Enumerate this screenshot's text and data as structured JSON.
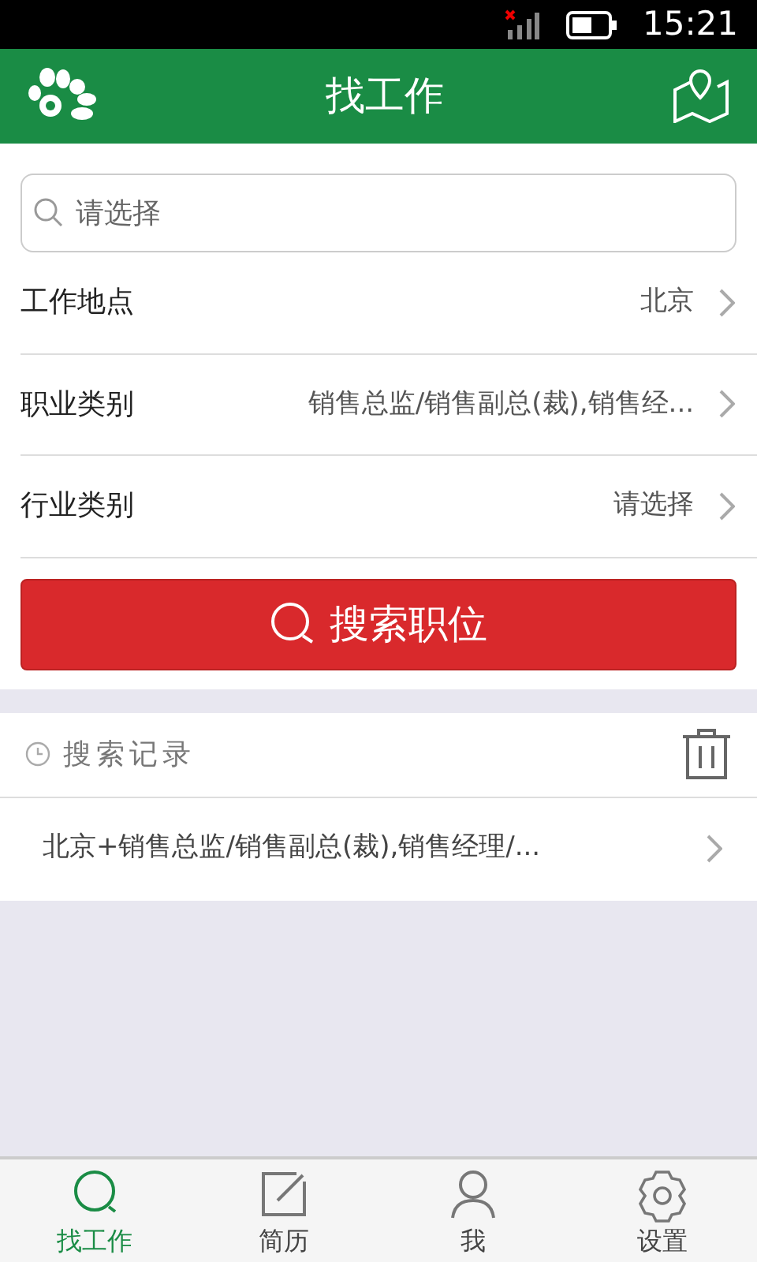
{
  "status_bar": {
    "time": "15:21"
  },
  "header": {
    "title": "找工作"
  },
  "search": {
    "placeholder": "请选择"
  },
  "filters": [
    {
      "label": "工作地点",
      "value": "北京"
    },
    {
      "label": "职业类别",
      "value": "销售总监/销售副总(裁),销售经..."
    },
    {
      "label": "行业类别",
      "value": "请选择"
    }
  ],
  "search_button": {
    "label": "搜索职位"
  },
  "history": {
    "title": "搜索记录",
    "items": [
      {
        "text": "北京+销售总监/销售副总(裁),销售经理/..."
      }
    ]
  },
  "tabs": [
    {
      "label": "找工作",
      "selected": true
    },
    {
      "label": "简历",
      "selected": false
    },
    {
      "label": "我",
      "selected": false
    },
    {
      "label": "设置",
      "selected": false
    }
  ]
}
